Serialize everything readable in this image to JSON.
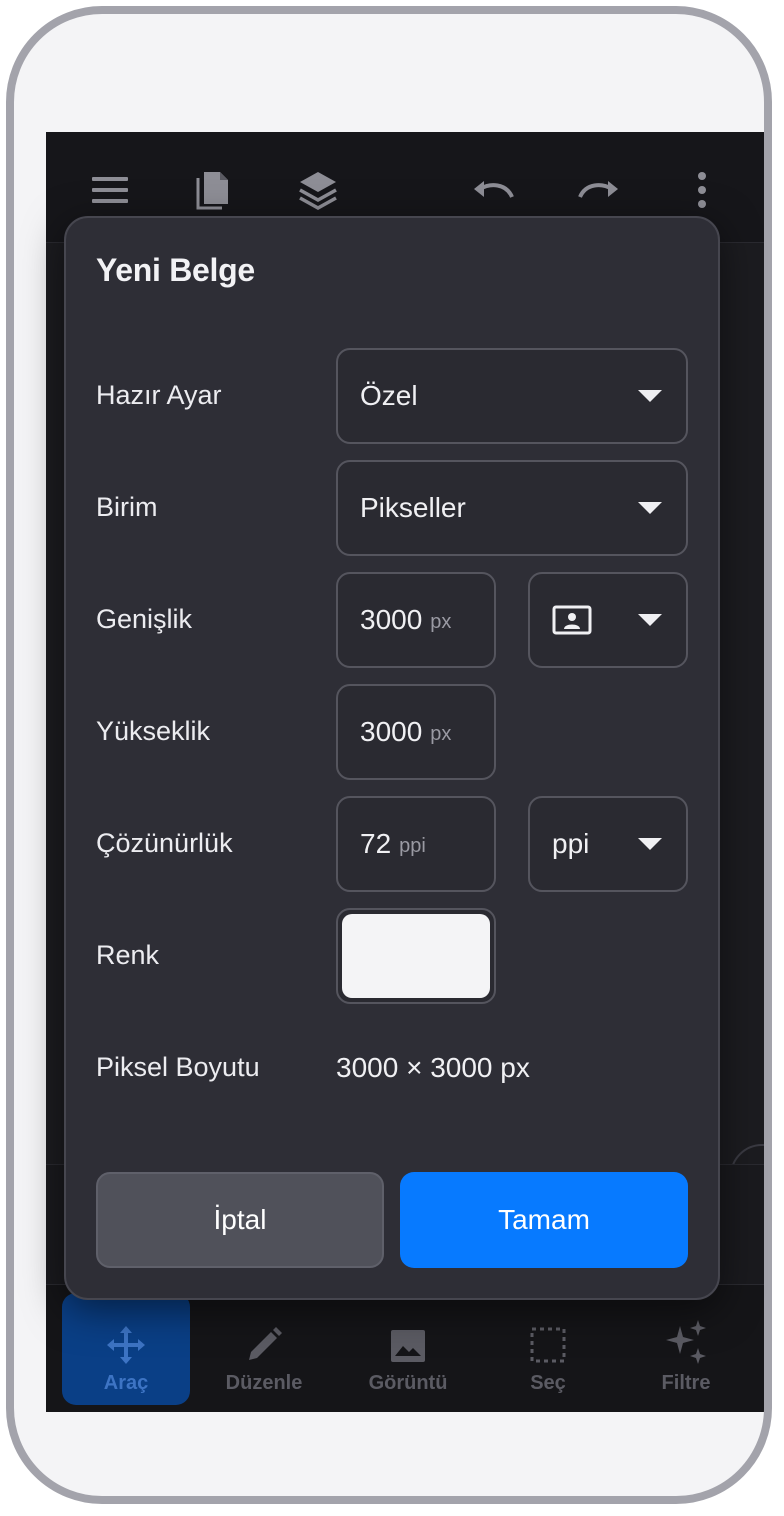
{
  "dialog": {
    "title": "Yeni Belge",
    "rows": {
      "preset": {
        "label": "Hazır Ayar",
        "value": "Özel"
      },
      "unit": {
        "label": "Birim",
        "value": "Pikseller"
      },
      "width": {
        "label": "Genişlik",
        "value": "3000",
        "unit": "px",
        "orientation_icon": "landscape-orientation-icon"
      },
      "height": {
        "label": "Yükseklik",
        "value": "3000",
        "unit": "px"
      },
      "resolution": {
        "label": "Çözünürlük",
        "value": "72",
        "unit": "ppi",
        "unit_select": "ppi"
      },
      "color": {
        "label": "Renk",
        "swatch_color": "#f4f4f6"
      },
      "pixel_size": {
        "label": "Piksel Boyutu",
        "value": "3000 × 3000 px"
      }
    },
    "cancel_label": "İptal",
    "ok_label": "Tamam"
  },
  "toolbar": {
    "icons": [
      "menu-icon",
      "documents-icon",
      "layers-icon",
      "undo-icon",
      "redo-icon",
      "more-vertical-icon"
    ]
  },
  "bottom_nav": {
    "items": [
      {
        "label": "Araç",
        "icon": "move-arrows-icon",
        "active": true
      },
      {
        "label": "Düzenle",
        "icon": "pencil-icon",
        "active": false
      },
      {
        "label": "Görüntü",
        "icon": "image-icon",
        "active": false
      },
      {
        "label": "Seç",
        "icon": "selection-icon",
        "active": false
      },
      {
        "label": "Filtre",
        "icon": "sparkle-icon",
        "active": false
      }
    ]
  },
  "colors": {
    "accent": "#077aff",
    "dialog_bg": "#2e2e36",
    "screen_bg": "#1c1c20",
    "nav_active_bg": "#0a3f86"
  }
}
